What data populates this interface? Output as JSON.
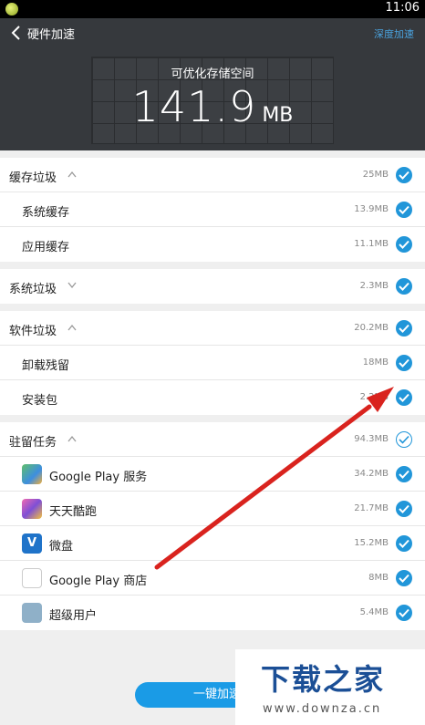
{
  "statusbar": {
    "time": "11:06"
  },
  "header": {
    "title": "硬件加速",
    "action": "深度加速",
    "storage_label": "可优化存储空间",
    "storage_value": "141.9",
    "storage_unit": "MB"
  },
  "sections": {
    "cache": {
      "title": "缓存垃圾",
      "size": "25MB",
      "items": [
        {
          "label": "系统缓存",
          "size": "13.9MB"
        },
        {
          "label": "应用缓存",
          "size": "11.1MB"
        }
      ]
    },
    "system": {
      "title": "系统垃圾",
      "size": "2.3MB"
    },
    "software": {
      "title": "软件垃圾",
      "size": "20.2MB",
      "items": [
        {
          "label": "卸载残留",
          "size": "18MB"
        },
        {
          "label": "安装包",
          "size": "2.2MB"
        }
      ]
    },
    "resident": {
      "title": "驻留任务",
      "size": "94.3MB",
      "items": [
        {
          "label": "Google Play 服务",
          "size": "34.2MB"
        },
        {
          "label": "天天酷跑",
          "size": "21.7MB"
        },
        {
          "label": "微盘",
          "size": "15.2MB"
        },
        {
          "label": "Google Play 商店",
          "size": "8MB"
        },
        {
          "label": "超级用户",
          "size": "5.4MB"
        }
      ]
    }
  },
  "button": {
    "label": "一键加速"
  },
  "watermark": {
    "text": "下载之家",
    "url": "www.downza.cn",
    "icon_letter": "V"
  },
  "colors": {
    "accent": "#2196d9",
    "header_bg": "#36393d",
    "arrow": "#d9231e"
  }
}
